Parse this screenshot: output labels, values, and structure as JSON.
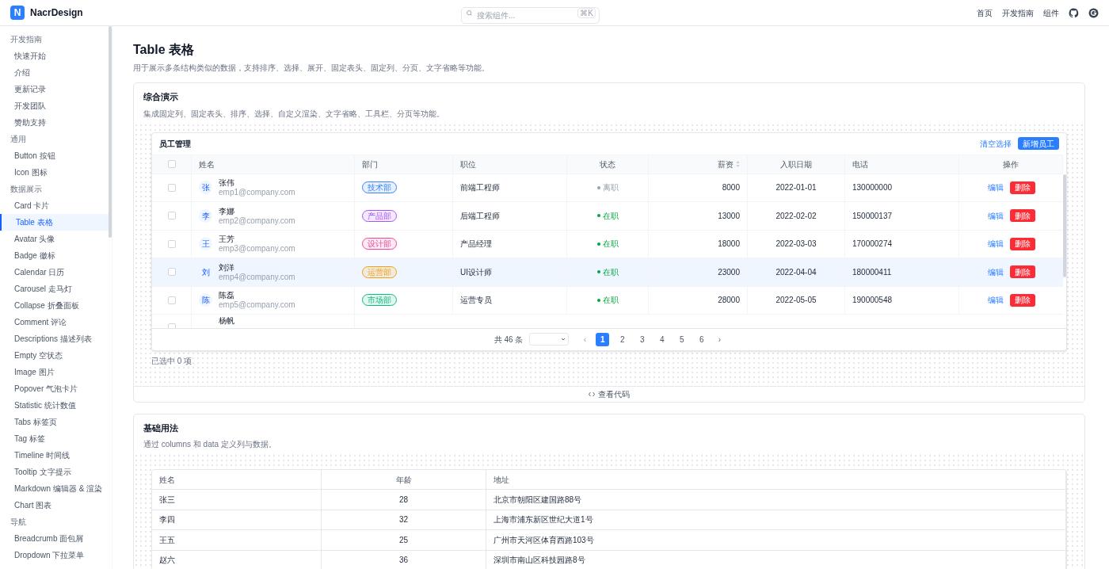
{
  "header": {
    "logo_letter": "N",
    "brand": "NacrDesign",
    "search": {
      "placeholder": "搜索组件...",
      "shortcut": "⌘K"
    },
    "nav": [
      "首页",
      "开发指南",
      "组件"
    ]
  },
  "sidebar": {
    "groups": [
      {
        "title": "开发指南",
        "items": [
          {
            "label": "快速开始",
            "selected": false
          },
          {
            "label": "介绍",
            "selected": false
          },
          {
            "label": "更新记录",
            "selected": false
          },
          {
            "label": "开发团队",
            "selected": false
          },
          {
            "label": "赞助支持",
            "selected": false
          }
        ]
      },
      {
        "title": "通用",
        "items": [
          {
            "label": "Button 按钮",
            "selected": false
          },
          {
            "label": "Icon 图标",
            "selected": false
          }
        ]
      },
      {
        "title": "数据展示",
        "items": [
          {
            "label": "Card 卡片",
            "selected": false
          },
          {
            "label": "Table 表格",
            "selected": true
          },
          {
            "label": "Avatar 头像",
            "selected": false
          },
          {
            "label": "Badge 徽标",
            "selected": false
          },
          {
            "label": "Calendar 日历",
            "selected": false
          },
          {
            "label": "Carousel 走马灯",
            "selected": false
          },
          {
            "label": "Collapse 折叠面板",
            "selected": false
          },
          {
            "label": "Comment 评论",
            "selected": false
          },
          {
            "label": "Descriptions 描述列表",
            "selected": false
          },
          {
            "label": "Empty 空状态",
            "selected": false
          },
          {
            "label": "Image 图片",
            "selected": false
          },
          {
            "label": "Popover 气泡卡片",
            "selected": false
          },
          {
            "label": "Statistic 统计数值",
            "selected": false
          },
          {
            "label": "Tabs 标签页",
            "selected": false
          },
          {
            "label": "Tag 标签",
            "selected": false
          },
          {
            "label": "Timeline 时间线",
            "selected": false
          },
          {
            "label": "Tooltip 文字提示",
            "selected": false
          },
          {
            "label": "Markdown 编辑器 & 渲染",
            "selected": false
          },
          {
            "label": "Chart 图表",
            "selected": false
          }
        ]
      },
      {
        "title": "导航",
        "items": [
          {
            "label": "Breadcrumb 面包屑",
            "selected": false
          },
          {
            "label": "Dropdown 下拉菜单",
            "selected": false
          }
        ]
      }
    ]
  },
  "page": {
    "title": "Table 表格",
    "description": "用于展示多条结构类似的数据，支持排序、选择、展开、固定表头、固定列、分页、文字省略等功能。"
  },
  "demo": {
    "title": "综合演示",
    "description": "集成固定列、固定表头、排序、选择、自定义渲染、文字省略、工具栏、分页等功能。",
    "table": {
      "title": "员工管理",
      "clear_button": "清空选择",
      "add_button": "新增员工",
      "columns": [
        "姓名",
        "部门",
        "职位",
        "状态",
        "薪资",
        "入职日期",
        "电话",
        "操作"
      ],
      "header_checked": false,
      "rows": [
        {
          "avatar": "张",
          "name": "张伟",
          "email": "emp1@company.com",
          "dept": "技术部",
          "color": "#3b82f6",
          "position": "前端工程师",
          "status": "离职",
          "active": false,
          "salary": "8000",
          "date": "2022-01-01",
          "phone": "130000000",
          "edit": "编辑",
          "delete": "删除",
          "checked": false,
          "hovered": false
        },
        {
          "avatar": "李",
          "name": "李娜",
          "email": "emp2@company.com",
          "dept": "产品部",
          "color": "#a855f7",
          "position": "后端工程师",
          "status": "在职",
          "active": true,
          "salary": "13000",
          "date": "2022-02-02",
          "phone": "150000137",
          "edit": "编辑",
          "delete": "删除",
          "checked": false,
          "hovered": false
        },
        {
          "avatar": "王",
          "name": "王芳",
          "email": "emp3@company.com",
          "dept": "设计部",
          "color": "#ec4899",
          "position": "产品经理",
          "status": "在职",
          "active": true,
          "salary": "18000",
          "date": "2022-03-03",
          "phone": "170000274",
          "edit": "编辑",
          "delete": "删除",
          "checked": false,
          "hovered": false
        },
        {
          "avatar": "刘",
          "name": "刘洋",
          "email": "emp4@company.com",
          "dept": "运营部",
          "color": "#f59e0b",
          "position": "UI设计师",
          "status": "在职",
          "active": true,
          "salary": "23000",
          "date": "2022-04-04",
          "phone": "180000411",
          "edit": "编辑",
          "delete": "删除",
          "checked": false,
          "hovered": true
        },
        {
          "avatar": "陈",
          "name": "陈磊",
          "email": "emp5@company.com",
          "dept": "市场部",
          "color": "#10b981",
          "position": "运营专员",
          "status": "在职",
          "active": true,
          "salary": "28000",
          "date": "2022-05-05",
          "phone": "190000548",
          "edit": "编辑",
          "delete": "删除",
          "checked": false,
          "hovered": false
        }
      ],
      "partial_row": {
        "name": "杨帆",
        "checked": false
      },
      "pagination": {
        "total": "共 46 条",
        "pages": [
          {
            "label": "1",
            "selected": true
          },
          {
            "label": "2",
            "selected": false
          },
          {
            "label": "3",
            "selected": false
          },
          {
            "label": "4",
            "selected": false
          },
          {
            "label": "5",
            "selected": false
          },
          {
            "label": "6",
            "selected": false
          }
        ],
        "prev": "‹",
        "next": "›"
      }
    },
    "selected_count": "已选中 0 项",
    "code_toggle": "查看代码"
  },
  "basic": {
    "title": "基础用法",
    "description": "通过 columns 和 data 定义列与数据。",
    "columns": [
      "姓名",
      "年龄",
      "地址"
    ],
    "rows": [
      [
        "张三",
        "28",
        "北京市朝阳区建国路88号"
      ],
      [
        "李四",
        "32",
        "上海市浦东新区世纪大道1号"
      ],
      [
        "王五",
        "25",
        "广州市天河区体育西路103号"
      ],
      [
        "赵六",
        "36",
        "深圳市南山区科技园路8号"
      ]
    ]
  }
}
